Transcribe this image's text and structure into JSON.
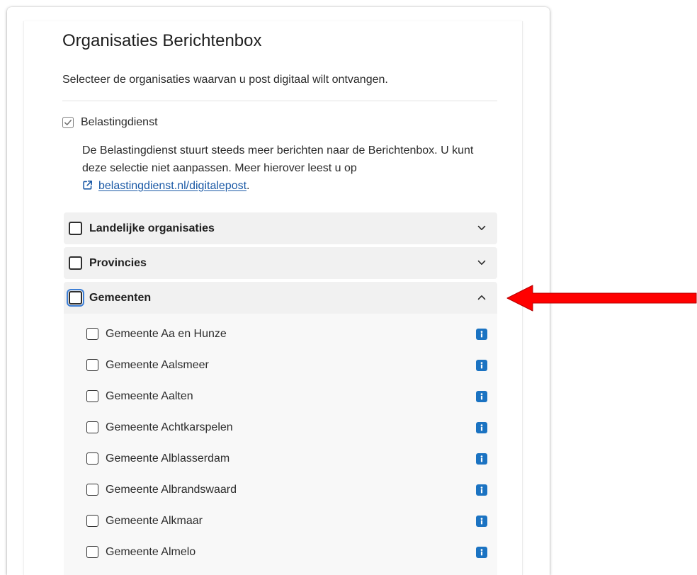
{
  "page": {
    "title": "Organisaties Berichtenbox",
    "subtitle": "Selecteer de organisaties waarvan u post digitaal wilt ontvangen."
  },
  "belastingdienst": {
    "label": "Belastingdienst",
    "checked": true,
    "disabled": true,
    "description": "De Belastingdienst stuurt steeds meer berichten naar de Berichtenbox. U kunt deze selectie niet aanpassen. Meer hierover leest u op",
    "link_icon": "external-link-icon",
    "link_text": "belastingdienst.nl/digitalepost",
    "link_suffix": "."
  },
  "groups": [
    {
      "label": "Landelijke organisaties",
      "checked": false,
      "expanded": false,
      "focused": false,
      "chevron_icon": "chevron-down-icon"
    },
    {
      "label": "Provincies",
      "checked": false,
      "expanded": false,
      "focused": false,
      "chevron_icon": "chevron-down-icon"
    },
    {
      "label": "Gemeenten",
      "checked": false,
      "expanded": true,
      "focused": true,
      "chevron_icon": "chevron-up-icon",
      "items": [
        {
          "label": "Gemeente Aa en Hunze",
          "checked": false,
          "info_icon": "info-icon"
        },
        {
          "label": "Gemeente Aalsmeer",
          "checked": false,
          "info_icon": "info-icon"
        },
        {
          "label": "Gemeente Aalten",
          "checked": false,
          "info_icon": "info-icon"
        },
        {
          "label": "Gemeente Achtkarspelen",
          "checked": false,
          "info_icon": "info-icon"
        },
        {
          "label": "Gemeente Alblasserdam",
          "checked": false,
          "info_icon": "info-icon"
        },
        {
          "label": "Gemeente Albrandswaard",
          "checked": false,
          "info_icon": "info-icon"
        },
        {
          "label": "Gemeente Alkmaar",
          "checked": false,
          "info_icon": "info-icon"
        },
        {
          "label": "Gemeente Almelo",
          "checked": false,
          "info_icon": "info-icon"
        }
      ]
    }
  ],
  "annotation": {
    "arrow_icon": "red-arrow-left-icon",
    "arrow_color": "#ff0000"
  },
  "colors": {
    "link": "#1c5aa6",
    "info_icon": "#1b73c2",
    "focus_ring": "#3d7fd6",
    "accordion_header": "#f1f1f1",
    "text": "#2a2a2a"
  }
}
